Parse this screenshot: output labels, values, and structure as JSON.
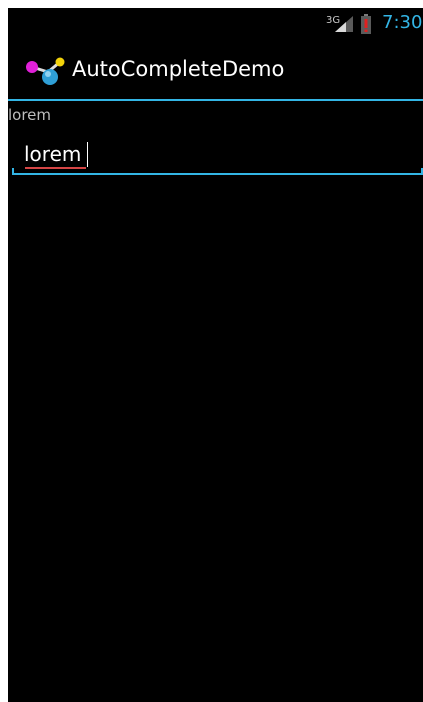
{
  "status_bar": {
    "network_type": "3G",
    "time": "7:30",
    "icons": [
      "signal-icon",
      "battery-low-icon"
    ],
    "clock_color": "#33b5e5"
  },
  "action_bar": {
    "app_icon": "app-molecule-icon",
    "title": "AutoCompleteDemo",
    "accent_color": "#33b5e5"
  },
  "content": {
    "selection_label": "lorem",
    "input_value": "lorem",
    "input_misspelled_underline_color": "#d64545"
  }
}
